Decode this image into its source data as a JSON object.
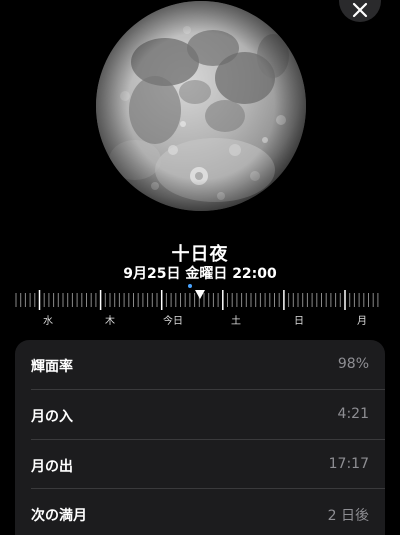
{
  "moon": {
    "phase_name": "十日夜",
    "date_time": "9月25日 金曜日 22:00",
    "illumination_fraction": 0.98
  },
  "timeline": {
    "days": [
      "水",
      "木",
      "今日",
      "土",
      "日",
      "月"
    ]
  },
  "details": {
    "rows": [
      {
        "label": "輝面率",
        "value": "98%"
      },
      {
        "label": "月の入",
        "value": "4:21"
      },
      {
        "label": "月の出",
        "value": "17:17"
      },
      {
        "label": "次の満月",
        "value": "2 日後"
      }
    ]
  },
  "colors": {
    "background": "#000000",
    "card": "#1c1c1e",
    "secondary_text": "#8e8e93",
    "now_indicator": "#4aa3ff"
  }
}
